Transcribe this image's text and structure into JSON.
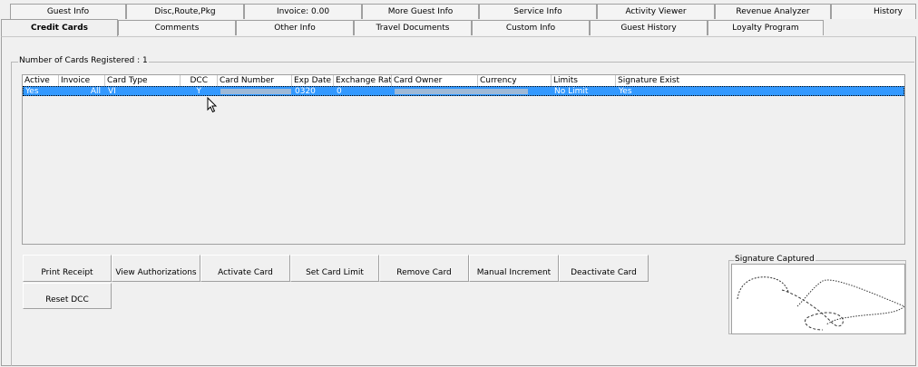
{
  "tabs_row1": [
    {
      "label": "Guest Info"
    },
    {
      "label": "Disc,Route,Pkg"
    },
    {
      "label": "Invoice: 0.00"
    },
    {
      "label": "More Guest Info"
    },
    {
      "label": "Service Info"
    },
    {
      "label": "Activity Viewer"
    },
    {
      "label": "Revenue Analyzer"
    },
    {
      "label": "History"
    }
  ],
  "tabs_row2": [
    {
      "label": "Credit Cards"
    },
    {
      "label": "Comments"
    },
    {
      "label": "Other Info"
    },
    {
      "label": "Travel Documents"
    },
    {
      "label": "Custom Info"
    },
    {
      "label": "Guest History"
    },
    {
      "label": "Loyalty Program"
    }
  ],
  "cards_group": {
    "label": "Number of Cards Registered : 1"
  },
  "grid": {
    "columns": [
      "Active",
      "Invoice",
      "Card Type",
      "DCC",
      "Card Number",
      "Exp Date",
      "Exchange Rate",
      "Card Owner",
      "Currency",
      "Limits",
      "Signature Exist"
    ],
    "rows": [
      {
        "active": "Yes",
        "invoice": "All",
        "card_type": "VI",
        "dcc": "Y",
        "card_number": "",
        "exp_date": "0320",
        "exchange_rate": "0",
        "card_owner": "",
        "currency": "",
        "limits": "No Limit",
        "signature_exist": "Yes"
      }
    ]
  },
  "buttons": {
    "print_receipt": "Print Receipt",
    "view_authorizations": "View Authorizations",
    "activate_card": "Activate Card",
    "set_card_limit": "Set Card Limit",
    "remove_card": "Remove Card",
    "manual_increment": "Manual Increment",
    "deactivate_card": "Deactivate Card",
    "reset_dcc": "Reset DCC"
  },
  "signature": {
    "label": "Signature Captured"
  },
  "colors": {
    "selection": "#3399ff",
    "window": "#f0f0f0"
  }
}
